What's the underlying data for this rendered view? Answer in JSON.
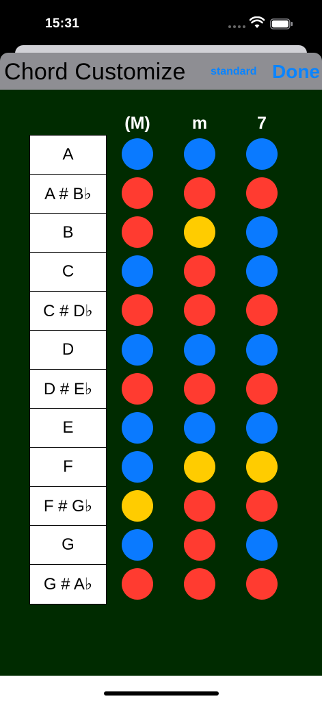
{
  "status_bar": {
    "time": "15:31"
  },
  "nav": {
    "title": "Chord   Customize",
    "standard_label": "standard",
    "done_label": "Done"
  },
  "columns": [
    "(M)",
    "m",
    "7"
  ],
  "rows": [
    {
      "chord": "A",
      "colors": [
        "blue",
        "blue",
        "blue"
      ]
    },
    {
      "chord": "A # B♭",
      "colors": [
        "red",
        "red",
        "red"
      ]
    },
    {
      "chord": "B",
      "colors": [
        "red",
        "yellow",
        "blue"
      ]
    },
    {
      "chord": "C",
      "colors": [
        "blue",
        "red",
        "blue"
      ]
    },
    {
      "chord": "C # D♭",
      "colors": [
        "red",
        "red",
        "red"
      ]
    },
    {
      "chord": "D",
      "colors": [
        "blue",
        "blue",
        "blue"
      ]
    },
    {
      "chord": "D # E♭",
      "colors": [
        "red",
        "red",
        "red"
      ]
    },
    {
      "chord": "E",
      "colors": [
        "blue",
        "blue",
        "blue"
      ]
    },
    {
      "chord": "F",
      "colors": [
        "blue",
        "yellow",
        "yellow"
      ]
    },
    {
      "chord": "F # G♭",
      "colors": [
        "yellow",
        "red",
        "red"
      ]
    },
    {
      "chord": "G",
      "colors": [
        "blue",
        "red",
        "blue"
      ]
    },
    {
      "chord": "G # A♭",
      "colors": [
        "red",
        "red",
        "red"
      ]
    }
  ],
  "palette": {
    "blue": "#0a7aff",
    "red": "#ff3b30",
    "yellow": "#ffcc00",
    "background": "#002b00",
    "nav": "#8e8e93"
  }
}
